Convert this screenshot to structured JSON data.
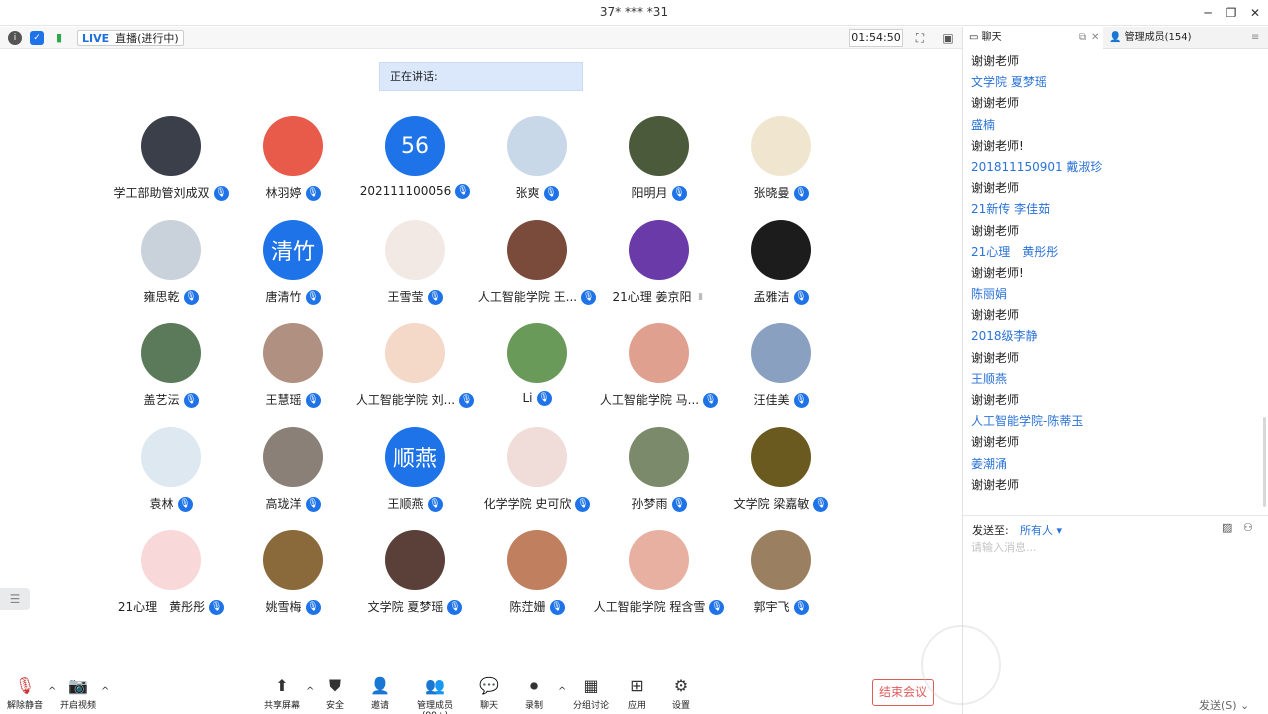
{
  "window": {
    "title": "37* *** *31",
    "minimize": "─",
    "restore": "❐",
    "close": "✕"
  },
  "topbar": {
    "live_label": "LIVE",
    "live_status": "直播(进行中)",
    "timer": "01:54:50",
    "info_icon": "i",
    "shield_icon": "✓",
    "signal_icon": "▮",
    "fullscreen_icon": "⛶",
    "layout_icon": "▣"
  },
  "speaking_label": "正在讲话:",
  "participants": [
    {
      "name": "学工部助管刘成双",
      "avatar_color": "#3a3f4a",
      "avatar_text": ""
    },
    {
      "name": "林羽婷",
      "avatar_color": "#e85a4a",
      "avatar_text": ""
    },
    {
      "name": "202111100056",
      "avatar_color": "#1e73e8",
      "avatar_text": "56"
    },
    {
      "name": "张爽",
      "avatar_color": "#c8d8e8",
      "avatar_text": ""
    },
    {
      "name": "阳明月",
      "avatar_color": "#4a5a3a",
      "avatar_text": ""
    },
    {
      "name": "张晓曼",
      "avatar_color": "#f0e6d0",
      "avatar_text": ""
    },
    {
      "name": "雍思乾",
      "avatar_color": "#c9d2da",
      "avatar_text": ""
    },
    {
      "name": "唐清竹",
      "avatar_color": "#1e73e8",
      "avatar_text": "清竹"
    },
    {
      "name": "王雪莹",
      "avatar_color": "#f2e9e4",
      "avatar_text": ""
    },
    {
      "name": "人工智能学院 王...",
      "avatar_color": "#7a4a3a",
      "avatar_text": ""
    },
    {
      "name": "21心理 姜京阳",
      "avatar_color": "#6a3aa8",
      "avatar_text": ""
    },
    {
      "name": "孟雅洁",
      "avatar_color": "#1c1c1c",
      "avatar_text": ""
    },
    {
      "name": "盖艺沄",
      "avatar_color": "#5a7a5a",
      "avatar_text": ""
    },
    {
      "name": "王慧瑶",
      "avatar_color": "#b09080",
      "avatar_text": ""
    },
    {
      "name": "人工智能学院 刘...",
      "avatar_color": "#f4d8c8",
      "avatar_text": ""
    },
    {
      "name": "Li",
      "avatar_color": "#6a9a5a",
      "avatar_text": ""
    },
    {
      "name": "人工智能学院 马...",
      "avatar_color": "#e0a090",
      "avatar_text": ""
    },
    {
      "name": "汪佳美",
      "avatar_color": "#8aa0c0",
      "avatar_text": ""
    },
    {
      "name": "袁林",
      "avatar_color": "#dde8f0",
      "avatar_text": ""
    },
    {
      "name": "高珑洋",
      "avatar_color": "#8a8078",
      "avatar_text": ""
    },
    {
      "name": "王顺燕",
      "avatar_color": "#1e73e8",
      "avatar_text": "顺燕"
    },
    {
      "name": "化学学院 史可欣",
      "avatar_color": "#f0dcd8",
      "avatar_text": ""
    },
    {
      "name": "孙梦雨",
      "avatar_color": "#7a8a6a",
      "avatar_text": ""
    },
    {
      "name": "文学院 梁嘉敏",
      "avatar_color": "#6a5a20",
      "avatar_text": ""
    },
    {
      "name": "21心理　黄彤彤",
      "avatar_color": "#f8d8d8",
      "avatar_text": ""
    },
    {
      "name": "姚雪梅",
      "avatar_color": "#8a6a3a",
      "avatar_text": ""
    },
    {
      "name": "文学院 夏梦瑶",
      "avatar_color": "#5a4038",
      "avatar_text": ""
    },
    {
      "name": "陈茳姗",
      "avatar_color": "#c08060",
      "avatar_text": ""
    },
    {
      "name": "人工智能学院 程含雪",
      "avatar_color": "#e8b0a0",
      "avatar_text": ""
    },
    {
      "name": "郭宇飞",
      "avatar_color": "#9a8060",
      "avatar_text": ""
    }
  ],
  "bottombar": {
    "unmute": "解除静音",
    "start_video": "开启视频",
    "share": "共享屏幕",
    "security": "安全",
    "invite": "邀请",
    "members": "管理成员(99+)",
    "chat": "聊天",
    "record": "录制",
    "breakout": "分组讨论",
    "apps": "应用",
    "settings": "设置",
    "end_meeting": "结束会议"
  },
  "panel": {
    "chat_tab": "聊天",
    "members_tab": "管理成员(154)",
    "messages": [
      {
        "text": "谢谢老师",
        "type": "msg"
      },
      {
        "text": "文学院 夏梦瑶",
        "type": "name"
      },
      {
        "text": "谢谢老师",
        "type": "msg"
      },
      {
        "text": "盛楠",
        "type": "name"
      },
      {
        "text": "谢谢老师!",
        "type": "msg"
      },
      {
        "text": "201811150901 戴淑珍",
        "type": "name"
      },
      {
        "text": "谢谢老师",
        "type": "msg"
      },
      {
        "text": "21新传 李佳茹",
        "type": "name"
      },
      {
        "text": "谢谢老师",
        "type": "msg"
      },
      {
        "text": "21心理　黄彤彤",
        "type": "name"
      },
      {
        "text": "谢谢老师!",
        "type": "msg"
      },
      {
        "text": "陈丽娟",
        "type": "name"
      },
      {
        "text": "谢谢老师",
        "type": "msg"
      },
      {
        "text": "2018级李静",
        "type": "name"
      },
      {
        "text": "谢谢老师",
        "type": "msg"
      },
      {
        "text": "王顺燕",
        "type": "name"
      },
      {
        "text": "谢谢老师",
        "type": "msg"
      },
      {
        "text": "人工智能学院-陈蒂玉",
        "type": "name"
      },
      {
        "text": "谢谢老师",
        "type": "msg"
      },
      {
        "text": "姜潮涌",
        "type": "name"
      },
      {
        "text": "谢谢老师",
        "type": "msg"
      }
    ],
    "send_to_label": "发送至:",
    "send_to_value": "所有人 ▾",
    "input_placeholder": "请输入消息...",
    "send_button": "发送(S)  ⌄"
  },
  "colors": {
    "accent": "#1e73e8",
    "name_blue": "#2a72d8",
    "end_red": "#e25b5b"
  }
}
